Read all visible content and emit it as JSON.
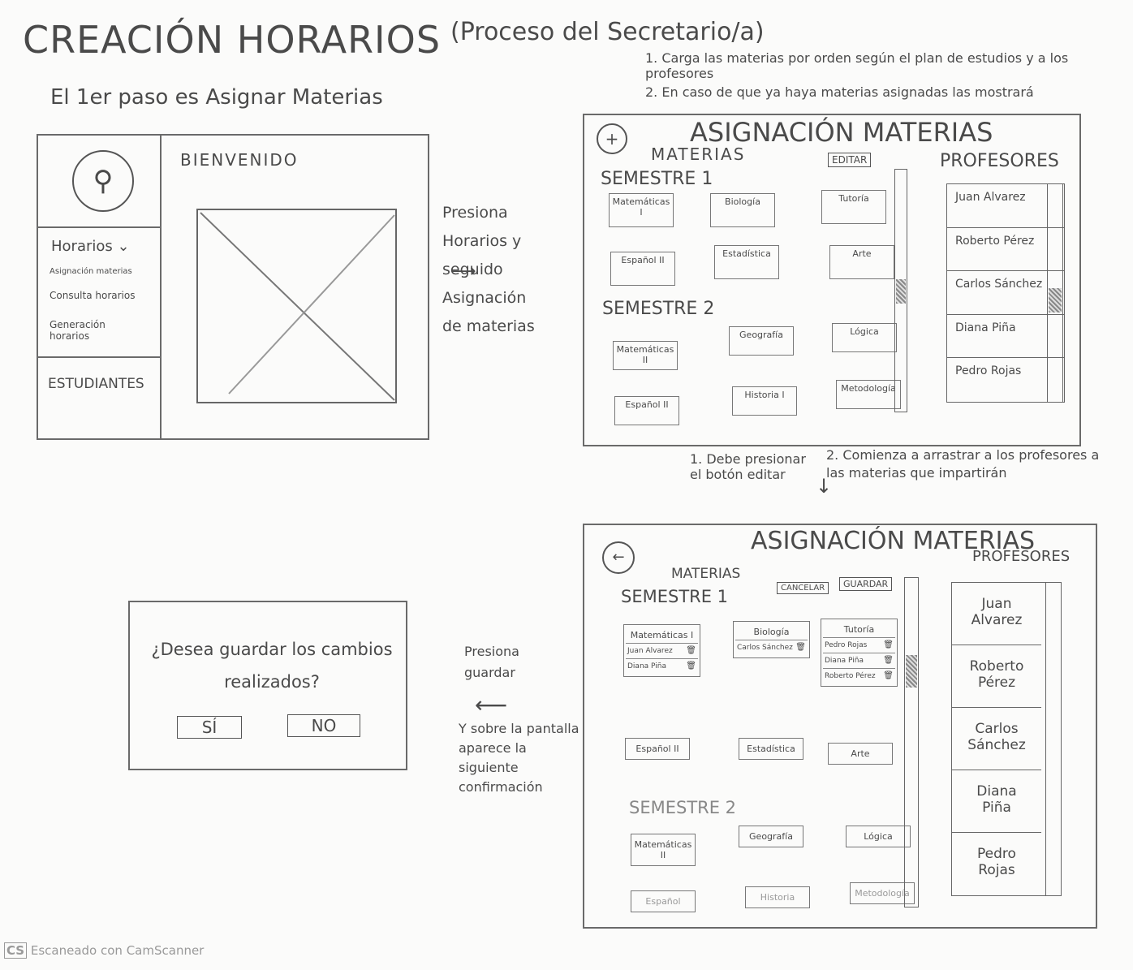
{
  "title": "CREACIÓN HORARIOS",
  "subtitle": "(Proceso del Secretario/a)",
  "notes_top": [
    "1. Carga las materias por orden según el plan de estudios y a los profesores",
    "2. En caso de que ya haya materias asignadas las mostrará"
  ],
  "step1": "El 1er paso es Asignar Materias",
  "home": {
    "welcome": "BIENVENIDO",
    "menu_header": "Horarios",
    "menu_items": [
      "Asignación materias",
      "Consulta horarios",
      "Generación horarios"
    ],
    "students": "ESTUDIANTES"
  },
  "instr1": [
    "Presiona",
    "Horarios y",
    "seguido",
    "Asignación",
    "de materias"
  ],
  "assign": {
    "title": "ASIGNACIÓN MATERIAS",
    "materias": "MATERIAS",
    "profesores": "PROFESORES",
    "edit": "EDITAR",
    "sem1": "SEMESTRE 1",
    "sem2": "SEMESTRE 2",
    "sem1_subjects": [
      "Matemáticas I",
      "Biología",
      "Tutoría",
      "Español II",
      "Estadística",
      "Arte"
    ],
    "sem2_subjects": [
      "Matemáticas II",
      "Geografía",
      "Lógica",
      "Español II",
      "Historia I",
      "Metodología"
    ],
    "teachers": [
      "Juan Alvarez",
      "Roberto Pérez",
      "Carlos Sánchez",
      "Diana Piña",
      "Pedro Rojas"
    ]
  },
  "instr2": {
    "step1": "1. Debe presionar el botón editar",
    "step2": "2. Comienza a arrastrar a los profesores a las materias que impartirán"
  },
  "edit": {
    "title": "ASIGNACIÓN MATERIAS",
    "materias": "MATERIAS",
    "profesores": "PROFESORES",
    "cancel": "CANCELAR",
    "save": "GUARDAR",
    "sem1": "SEMESTRE 1",
    "sem2": "SEMESTRE 2",
    "cards": [
      {
        "name": "Matemáticas I",
        "assigned": [
          "Juan Alvarez",
          "Diana Piña"
        ]
      },
      {
        "name": "Biología",
        "assigned": [
          "Carlos Sánchez"
        ]
      },
      {
        "name": "Tutoría",
        "assigned": [
          "Pedro Rojas",
          "Diana Piña",
          "Roberto Pérez"
        ]
      },
      {
        "name": "Español II",
        "assigned": []
      },
      {
        "name": "Estadística",
        "assigned": []
      },
      {
        "name": "Arte",
        "assigned": []
      },
      {
        "name": "Matemáticas II",
        "assigned": []
      },
      {
        "name": "Geografía",
        "assigned": []
      },
      {
        "name": "Lógica",
        "assigned": []
      },
      {
        "name": "Español",
        "assigned": []
      },
      {
        "name": "Historia",
        "assigned": []
      },
      {
        "name": "Metodología",
        "assigned": []
      }
    ],
    "teachers": [
      "Juan Alvarez",
      "Roberto Pérez",
      "Carlos Sánchez",
      "Diana Piña",
      "Pedro Rojas"
    ]
  },
  "instr3": {
    "a": "Presiona guardar",
    "b": "Y sobre la pantalla aparece la siguiente confirmación"
  },
  "dialog": {
    "question": "¿Desea guardar los cambios realizados?",
    "yes": "SÍ",
    "no": "NO"
  },
  "footer": {
    "badge": "CS",
    "text": "Escaneado con CamScanner"
  }
}
